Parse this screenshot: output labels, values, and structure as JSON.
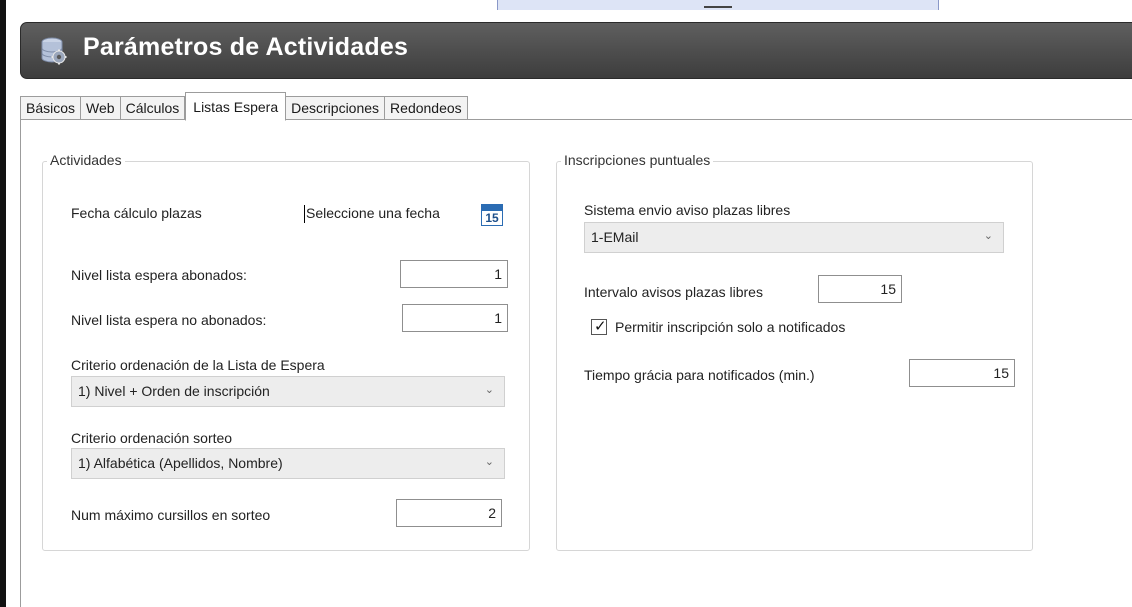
{
  "window": {
    "title": "Parámetros de Actividades",
    "icon": "database-gear-icon"
  },
  "tabs": [
    {
      "label": "Básicos",
      "active": false
    },
    {
      "label": "Web",
      "active": false
    },
    {
      "label": "Cálculos",
      "active": false
    },
    {
      "label": "Listas Espera",
      "active": true
    },
    {
      "label": "Descripciones",
      "active": false
    },
    {
      "label": "Redondeos",
      "active": false
    }
  ],
  "actividades": {
    "legend": "Actividades",
    "fecha_label": "Fecha cálculo plazas",
    "fecha_placeholder": "Seleccione una fecha",
    "calendar_day": "15",
    "nivel_abonados_label": "Nivel lista espera abonados:",
    "nivel_abonados_value": "1",
    "nivel_no_abonados_label": "Nivel lista espera no abonados:",
    "nivel_no_abonados_value": "1",
    "criterio_lista_label": "Criterio ordenación de la Lista de Espera",
    "criterio_lista_value": "1) Nivel + Orden de inscripción",
    "criterio_sorteo_label": "Criterio ordenación sorteo",
    "criterio_sorteo_value": "1) Alfabética (Apellidos, Nombre)",
    "num_max_label": "Num máximo cursillos en sorteo",
    "num_max_value": "2"
  },
  "inscripciones": {
    "legend": "Inscripciones puntuales",
    "sistema_label": "Sistema envio aviso plazas libres",
    "sistema_value": "1-EMail",
    "intervalo_label": "Intervalo avisos plazas libres",
    "intervalo_value": "15",
    "permitir_label": "Permitir inscripción solo a notificados",
    "permitir_checked": true,
    "tiempo_label": "Tiempo grácia para notificados (min.)",
    "tiempo_value": "15"
  },
  "colors": {
    "title_bar": "#4a4a4a",
    "calendar_accent": "#2b6cb3",
    "combo_bg": "#ededed"
  }
}
